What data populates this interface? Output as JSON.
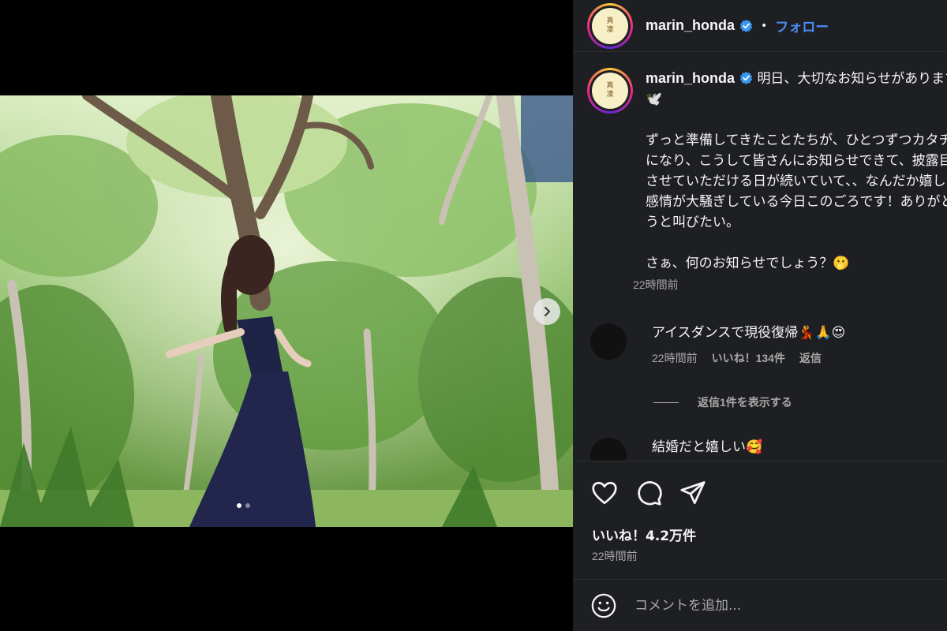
{
  "post": {
    "username": "marin_honda",
    "follow_label": "フォロー",
    "separator": "•",
    "avatar_text_top": "真",
    "avatar_text_bottom": "凜",
    "caption": "明日、大切なお知らせがあります🕊️\n\nずっと準備してきたことたちが、ひとつずつカタチになり、こうして皆さんにお知らせできて、披露目させていただける日が続いていて、、なんだか嬉しい感情が大騒ぎしている今日このごろです！ありがとうと叫びたい。\n\nさぁ、何のお知らせでしょう？🫢",
    "caption_time": "22時間前",
    "likes": "いいね！4.2万件",
    "time": "22時間前"
  },
  "comments": [
    {
      "text": "アイスダンスで現役復帰💃🙏😍",
      "time": "22時間前",
      "likes": "いいね！134件",
      "reply": "返信"
    },
    {
      "text": "結婚だと嬉しい🥰"
    }
  ],
  "view_replies": "返信1件を表示する",
  "add_comment_placeholder": "コメントを追加...",
  "carousel": {
    "current": 1,
    "total": 2
  },
  "colors": {
    "accent": "#4c8cf7",
    "panel": "#1e1f22",
    "muted": "#a8a8a8"
  },
  "icons": [
    "verified-badge-icon",
    "chevron-right-icon",
    "heart-icon",
    "comment-icon",
    "share-icon",
    "emoji-icon"
  ]
}
